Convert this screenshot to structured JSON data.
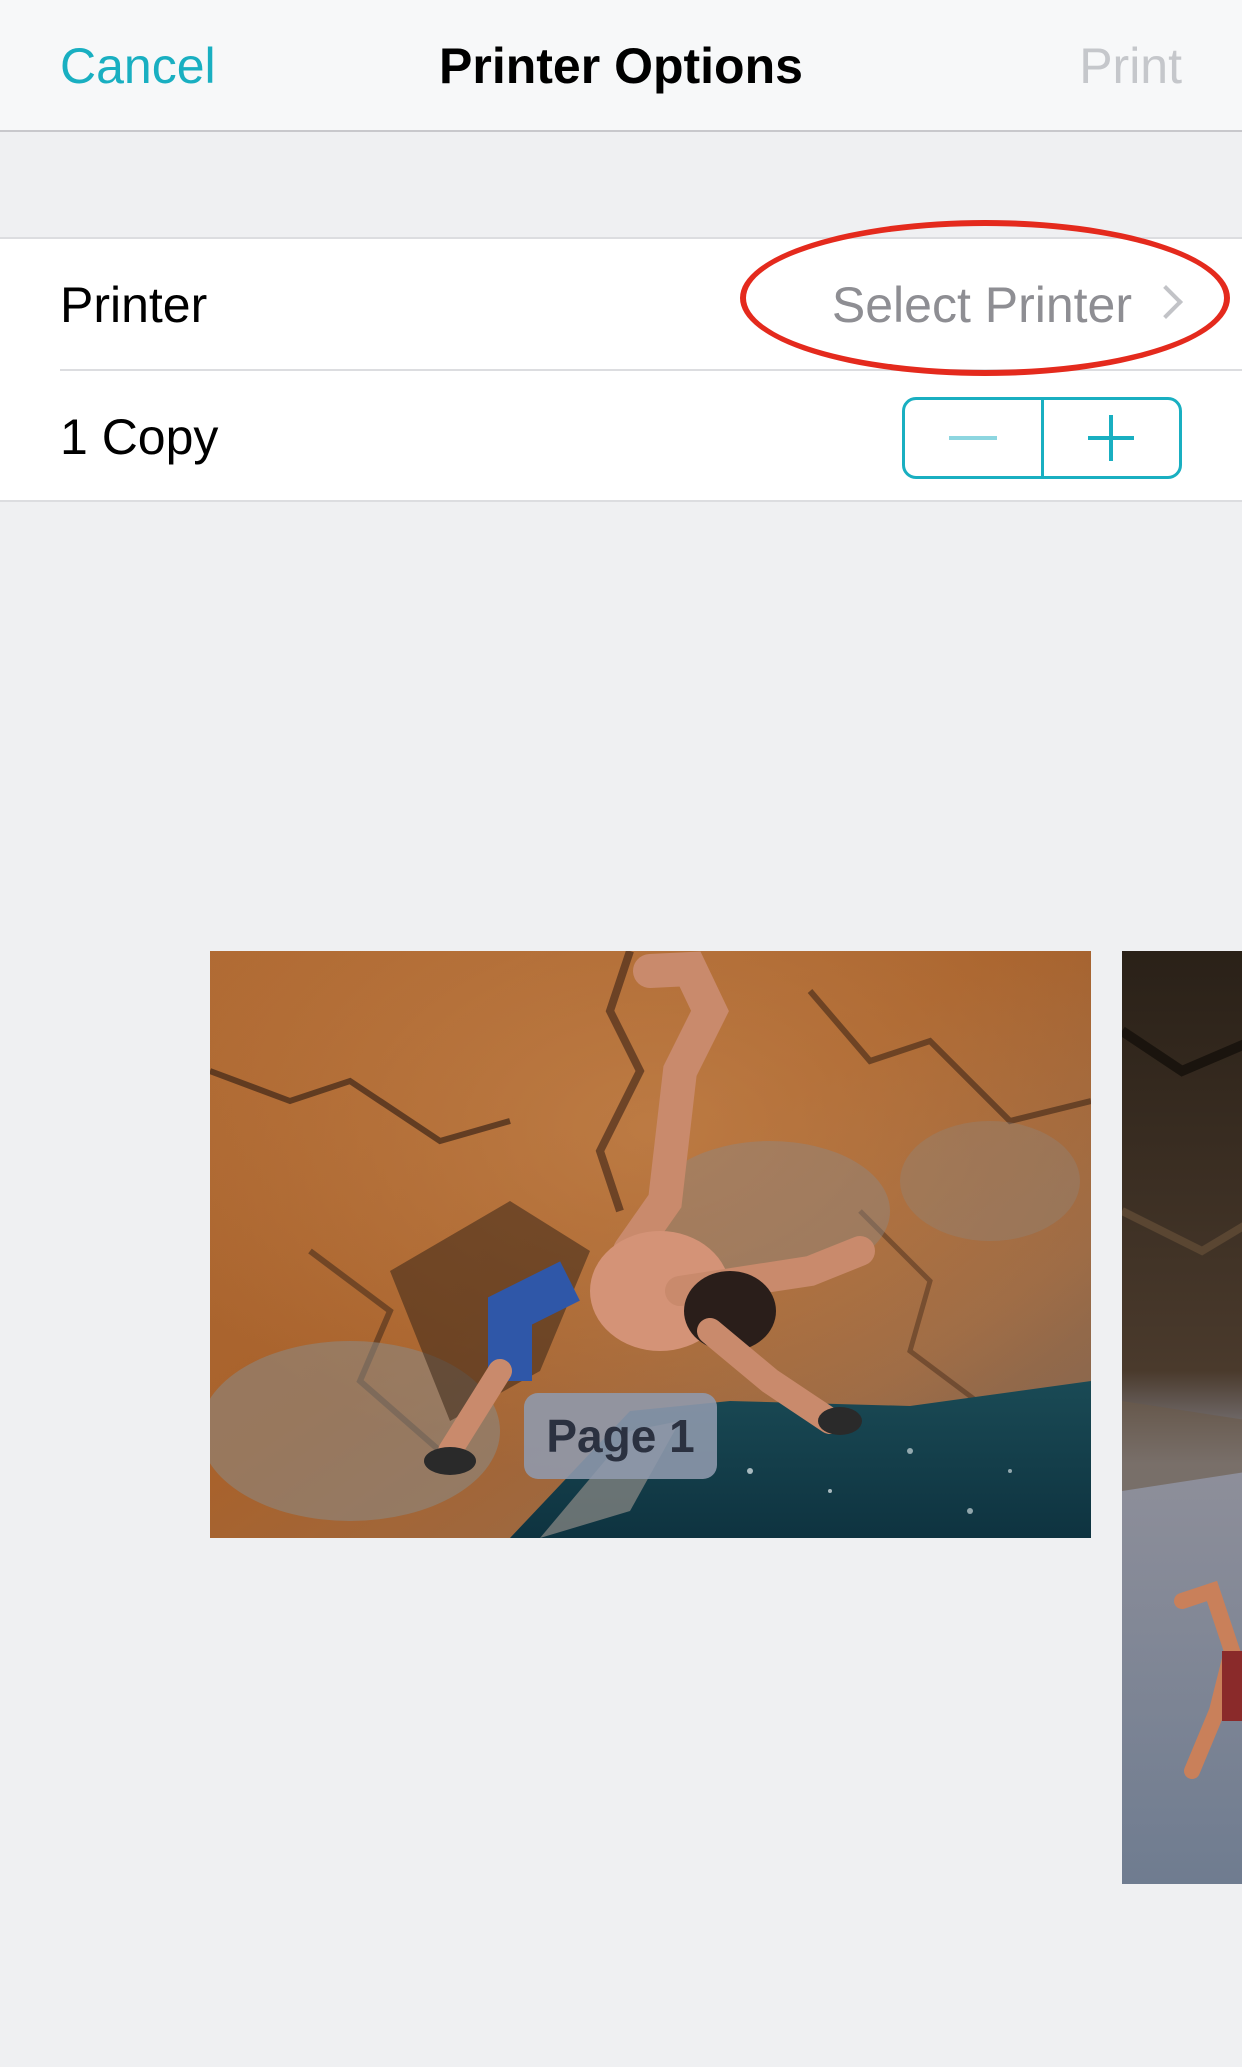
{
  "accent_color": "#19afc1",
  "annotation_color": "#e42a1d",
  "navbar": {
    "cancel_label": "Cancel",
    "title": "Printer Options",
    "print_label": "Print"
  },
  "settings": {
    "printer_label": "Printer",
    "printer_value": "Select Printer",
    "copies_label": "1 Copy",
    "stepper_minus_icon": "minus-icon",
    "stepper_plus_icon": "plus-icon",
    "disclosure_icon": "chevron-right-icon"
  },
  "preview": {
    "pages": [
      {
        "badge": "Page 1",
        "image": "rock-climber-over-sea-photo"
      },
      {
        "image": "climber-in-sea-cave-photo"
      }
    ]
  }
}
